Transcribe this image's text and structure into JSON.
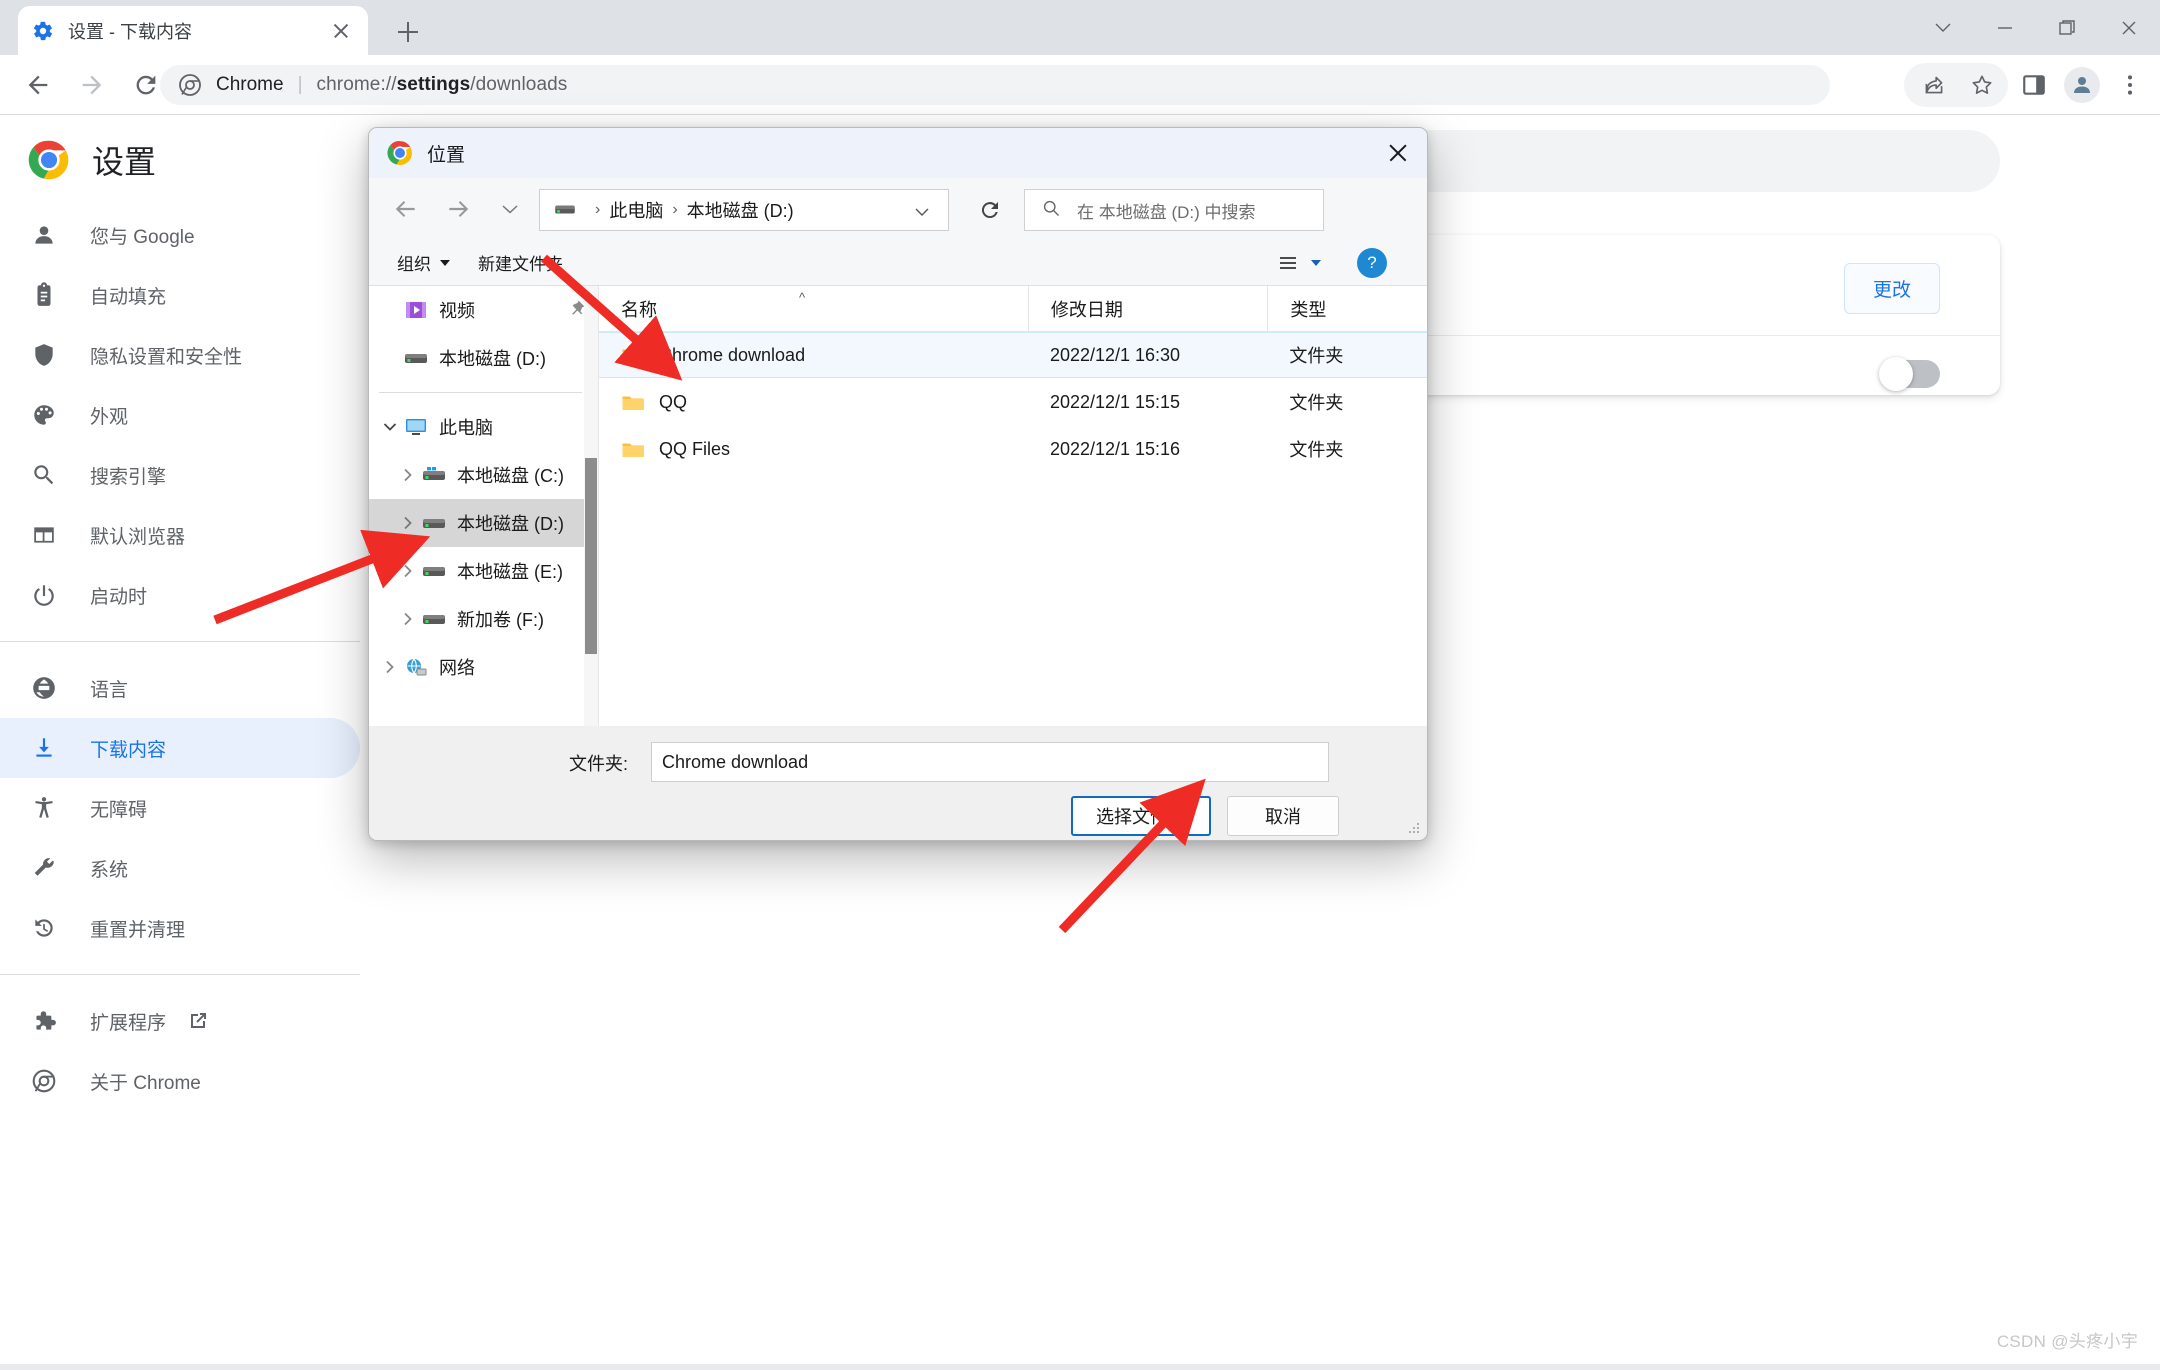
{
  "browser": {
    "tab": {
      "title": "设置 - 下载内容",
      "favicon": "gear-icon",
      "close": "close-icon"
    },
    "new_tab_label": "+",
    "omnibox": {
      "site_label": "Chrome",
      "separator": "|",
      "url_prefix": "chrome://",
      "url_bold": "settings",
      "url_suffix": "/downloads"
    },
    "window_controls": [
      "chevron-down-icon",
      "minimize-icon",
      "restore-icon",
      "close-icon"
    ],
    "toolbar_right_icons": [
      "share-icon",
      "star-icon",
      "side-panel-icon",
      "profile-avatar-icon",
      "more-vertical-icon"
    ],
    "nav_icons": [
      "back-icon",
      "forward-icon",
      "reload-icon"
    ]
  },
  "settings": {
    "title": "设置",
    "nav": [
      {
        "label": "您与 Google",
        "icon": "person-icon",
        "active": false
      },
      {
        "label": "自动填充",
        "icon": "clipboard-icon",
        "active": false
      },
      {
        "label": "隐私设置和安全性",
        "icon": "shield-icon",
        "active": false
      },
      {
        "label": "外观",
        "icon": "palette-icon",
        "active": false
      },
      {
        "label": "搜索引擎",
        "icon": "search-icon",
        "active": false
      },
      {
        "label": "默认浏览器",
        "icon": "browser-window-icon",
        "active": false
      },
      {
        "label": "启动时",
        "icon": "power-icon",
        "active": false
      },
      {
        "label": "语言",
        "icon": "globe-icon",
        "active": false
      },
      {
        "label": "下载内容",
        "icon": "download-icon",
        "active": true
      },
      {
        "label": "无障碍",
        "icon": "accessibility-icon",
        "active": false
      },
      {
        "label": "系统",
        "icon": "wrench-icon",
        "active": false
      },
      {
        "label": "重置并清理",
        "icon": "restore-history-icon",
        "active": false
      },
      {
        "label": "扩展程序",
        "icon": "puzzle-icon",
        "active": false,
        "external": true
      },
      {
        "label": "关于 Chrome",
        "icon": "chrome-icon",
        "active": false
      }
    ],
    "change_button": "更改",
    "toggle_state": "off"
  },
  "dialog": {
    "title": "位置",
    "title_icon": "chrome-icon",
    "close_icon": "close-icon",
    "nav_buttons": [
      "back-icon",
      "forward-icon",
      "recent-locations-icon",
      "up-icon"
    ],
    "address": {
      "drive_icon": "drive-icon",
      "crumbs": [
        "此电脑",
        "本地磁盘 (D:)"
      ],
      "dropdown_icon": "chevron-down-icon"
    },
    "refresh_icon": "refresh-icon",
    "search": {
      "icon": "search-icon",
      "placeholder": "在 本地磁盘 (D:) 中搜索",
      "value": ""
    },
    "commands": {
      "organize": "组织",
      "new_folder": "新建文件夹"
    },
    "view_icon": "list-view-icon",
    "help_icon": "help-icon",
    "tree": [
      {
        "label": "视频",
        "icon": "video-folder-icon",
        "indent": 1,
        "twisty": "none",
        "pinned": true,
        "selected": false
      },
      {
        "label": "本地磁盘 (D:)",
        "icon": "drive-icon",
        "indent": 1,
        "twisty": "none",
        "pinned": false,
        "selected": false
      },
      {
        "label": "此电脑",
        "icon": "pc-icon",
        "indent": 0,
        "twisty": "expanded",
        "pinned": false,
        "selected": false
      },
      {
        "label": "本地磁盘 (C:)",
        "icon": "drive-windows-icon",
        "indent": 1,
        "twisty": "collapsed",
        "pinned": false,
        "selected": false
      },
      {
        "label": "本地磁盘 (D:)",
        "icon": "drive-icon",
        "indent": 1,
        "twisty": "collapsed",
        "pinned": false,
        "selected": true
      },
      {
        "label": "本地磁盘 (E:)",
        "icon": "drive-icon",
        "indent": 1,
        "twisty": "collapsed",
        "pinned": false,
        "selected": false
      },
      {
        "label": "新加卷 (F:)",
        "icon": "drive-icon",
        "indent": 1,
        "twisty": "collapsed",
        "pinned": false,
        "selected": false
      },
      {
        "label": "网络",
        "icon": "network-icon",
        "indent": 0,
        "twisty": "collapsed",
        "pinned": false,
        "selected": false
      }
    ],
    "columns": [
      "名称",
      "修改日期",
      "类型"
    ],
    "rows": [
      {
        "name": "Chrome download",
        "date": "2022/12/1 16:30",
        "type": "文件夹",
        "selected": true
      },
      {
        "name": "QQ",
        "date": "2022/12/1 15:15",
        "type": "文件夹",
        "selected": false
      },
      {
        "name": "QQ Files",
        "date": "2022/12/1 15:16",
        "type": "文件夹",
        "selected": false
      }
    ],
    "footer": {
      "folder_label": "文件夹:",
      "folder_value": "Chrome download",
      "select_button": "选择文件夹",
      "cancel_button": "取消"
    }
  },
  "watermark": "CSDN @头疼小宇",
  "colors": {
    "accent_blue": "#1a73e8",
    "dialog_title_bg": "#eef2fa",
    "selected_row": "#f2f8fd",
    "arrow_red": "#ee2b24",
    "folder_yellow": "#fdc02f"
  }
}
